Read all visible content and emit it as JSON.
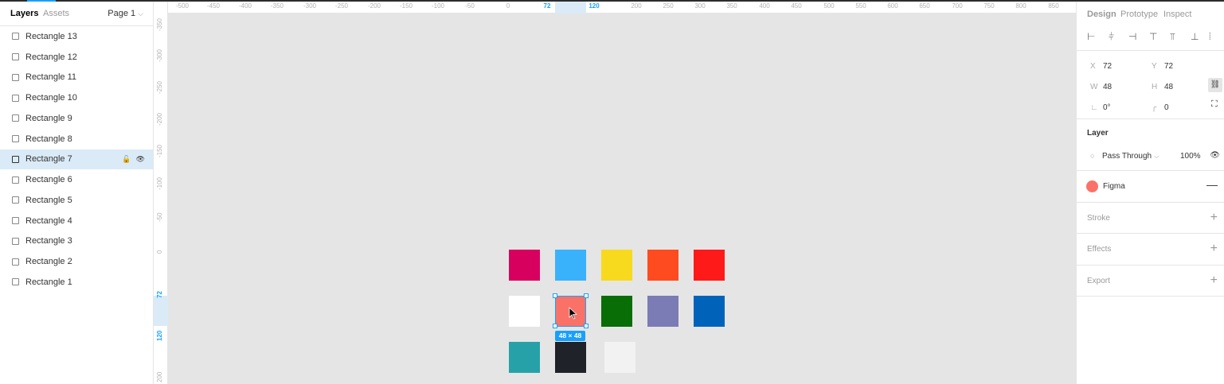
{
  "left_panel": {
    "tabs": {
      "layers": "Layers",
      "assets": "Assets"
    },
    "page": "Page 1",
    "layers": [
      "Rectangle 13",
      "Rectangle 12",
      "Rectangle 11",
      "Rectangle 10",
      "Rectangle 9",
      "Rectangle 8",
      "Rectangle 7",
      "Rectangle 6",
      "Rectangle 5",
      "Rectangle 4",
      "Rectangle 3",
      "Rectangle 2",
      "Rectangle 1"
    ],
    "selected_layer": "Rectangle 7"
  },
  "rulers": {
    "top_ticks": [
      "-500",
      "-450",
      "-400",
      "-350",
      "-300",
      "-250",
      "-200",
      "-150",
      "-100",
      "-50",
      "0",
      "72",
      "120",
      "200",
      "250",
      "300",
      "350",
      "400",
      "450",
      "500",
      "550",
      "600",
      "650",
      "700",
      "750",
      "800",
      "850"
    ],
    "left_ticks": [
      "-350",
      "-300",
      "-250",
      "-200",
      "-150",
      "-100",
      "-50",
      "0",
      "72",
      "120",
      "200"
    ]
  },
  "canvas": {
    "swatches": [
      "#d8005f",
      "#3ab1fb",
      "#f7da1e",
      "#ff4b1f",
      "#ff1a1a",
      "#ffffff",
      "#fa7267",
      "#0a6e06",
      "#7b7bb5",
      "#0063ba",
      "#27a1a8",
      "#1f2228",
      "#f2f2f2"
    ],
    "selection_size": "48 × 48"
  },
  "right_panel": {
    "tabs": {
      "design": "Design",
      "prototype": "Prototype",
      "inspect": "Inspect"
    },
    "x": "72",
    "y": "72",
    "w": "48",
    "h": "48",
    "rotation": "0°",
    "radius": "0",
    "labels": {
      "x": "X",
      "y": "Y",
      "w": "W",
      "h": "H"
    },
    "layer": {
      "title": "Layer",
      "blend": "Pass Through",
      "opacity": "100%"
    },
    "fill": {
      "name": "Figma",
      "color": "#fa7267"
    },
    "stroke": "Stroke",
    "effects": "Effects",
    "export": "Export"
  }
}
